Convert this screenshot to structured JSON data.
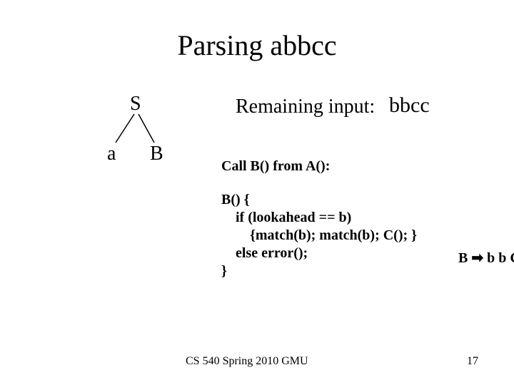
{
  "title": "Parsing abbcc",
  "tree": {
    "root": "S",
    "left": "a",
    "right": "B"
  },
  "remaining": {
    "label": "Remaining input:",
    "value": "bbcc"
  },
  "call_text": "Call B() from A():",
  "code": "B() {\n    if (lookahead == b)\n        {match(b); match(b); C(); }\n    else error();\n}",
  "rule": {
    "lhs": "B ",
    "arrow": "➡",
    "rhs": " b b C"
  },
  "footer": "CS 540 Spring 2010 GMU",
  "pagenum": "17"
}
